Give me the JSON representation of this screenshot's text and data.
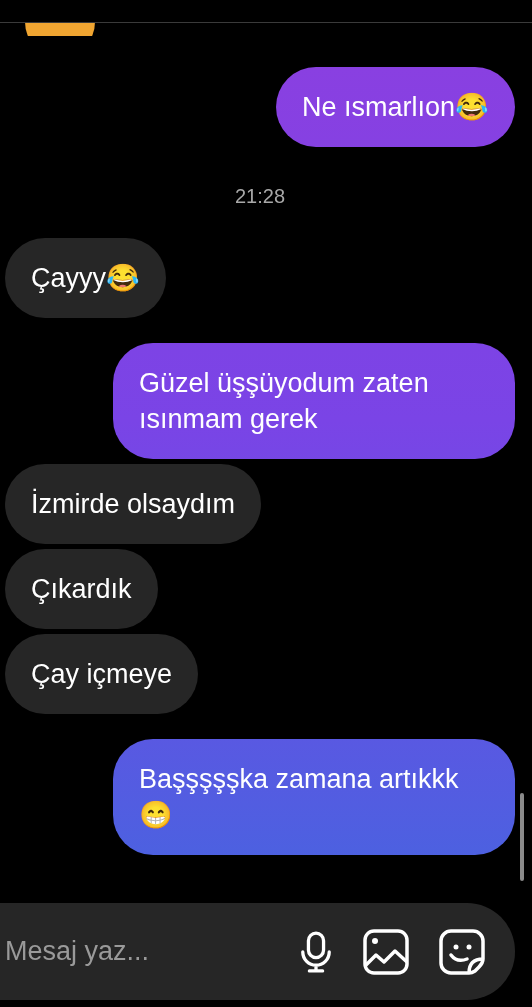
{
  "messages": [
    {
      "kind": "outgoing",
      "text": "Ne ısmarlıon😂"
    },
    {
      "kind": "timestamp",
      "text": "21:28"
    },
    {
      "kind": "incoming",
      "text": "Çayyy😂"
    },
    {
      "kind": "outgoing",
      "text": "Güzel üşşüyodum zaten ısınmam gerek"
    },
    {
      "kind": "incoming",
      "text": "İzmirde olsaydım"
    },
    {
      "kind": "incoming",
      "text": "Çıkardık"
    },
    {
      "kind": "incoming",
      "text": "Çay içmeye"
    },
    {
      "kind": "outgoing",
      "text": "Başşşşşka zamana artıkkk 😁"
    }
  ],
  "composer": {
    "placeholder": "Mesaj yaz..."
  }
}
